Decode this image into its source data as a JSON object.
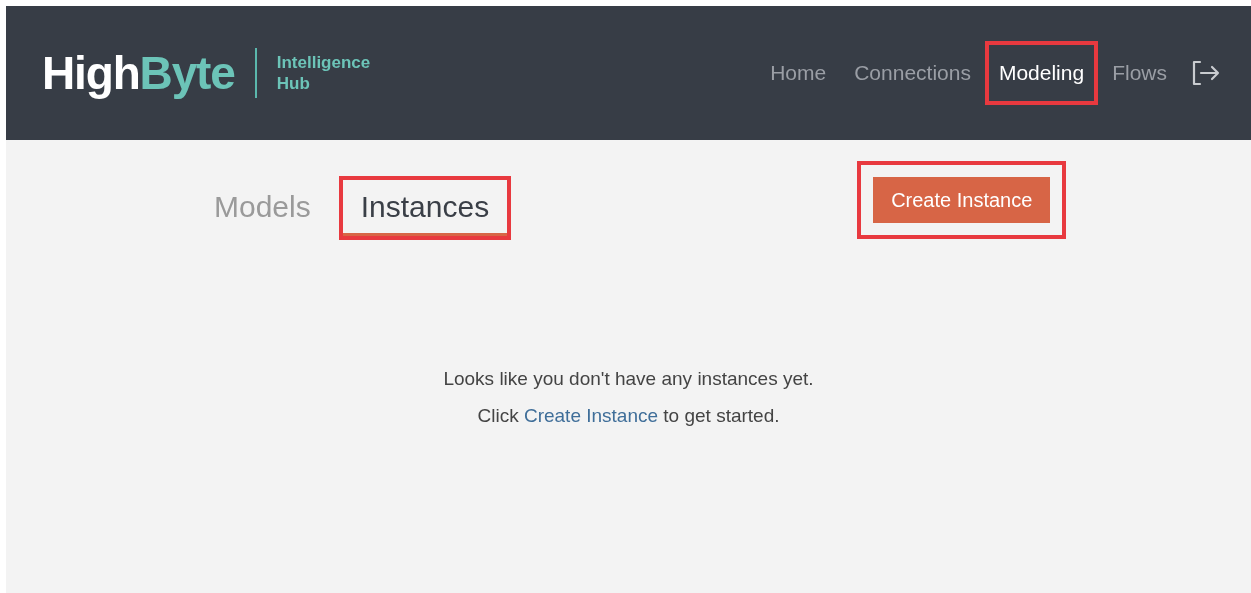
{
  "header": {
    "logo": {
      "primary": "High",
      "accent": "Byte"
    },
    "product": "Intelligence Hub",
    "nav": [
      {
        "label": "Home",
        "selected": false,
        "highlighted": false
      },
      {
        "label": "Connections",
        "selected": false,
        "highlighted": false
      },
      {
        "label": "Modeling",
        "selected": true,
        "highlighted": true
      },
      {
        "label": "Flows",
        "selected": false,
        "highlighted": false
      }
    ]
  },
  "tabs": [
    {
      "label": "Models",
      "selected": false,
      "highlighted": false
    },
    {
      "label": "Instances",
      "selected": true,
      "highlighted": true
    }
  ],
  "create_button": {
    "label": "Create Instance",
    "highlighted": true
  },
  "empty_state": {
    "line_1": "Looks like you don't have any instances yet.",
    "line_2_before": "Click",
    "link": "Create Instance",
    "line_2_after": "to get started."
  }
}
